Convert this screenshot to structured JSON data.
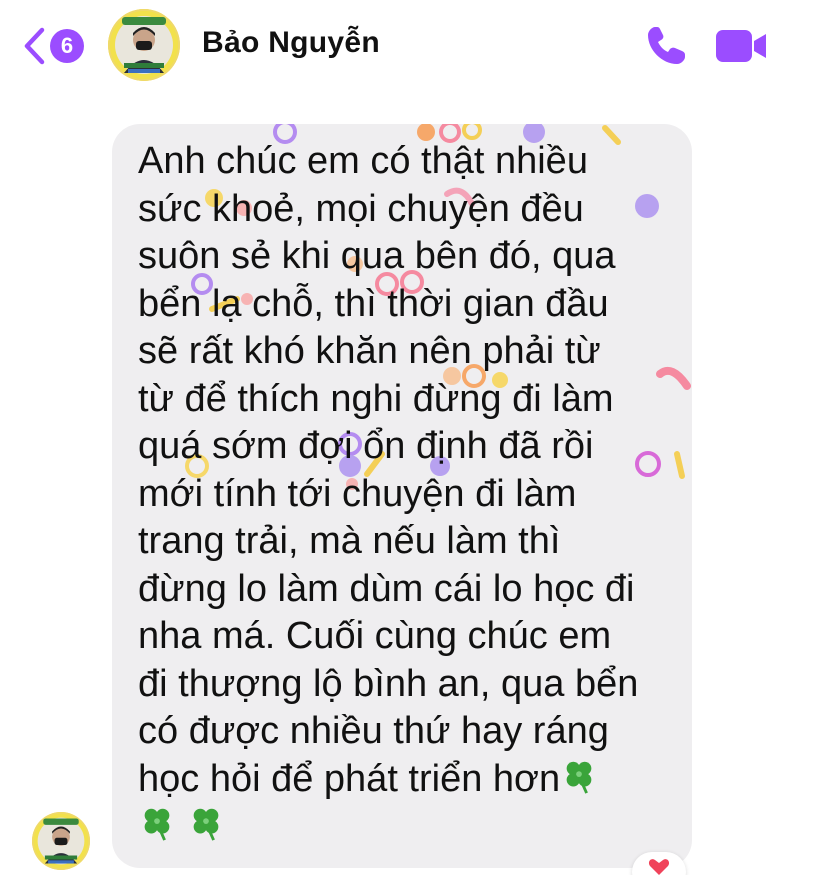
{
  "header": {
    "back_badge": "6",
    "contact_name": "Bảo Nguyễn",
    "avatar_icon": "profile-avatar",
    "call_icon": "phone-icon",
    "video_icon": "video-camera-icon",
    "accent_color": "#9b4dff"
  },
  "message": {
    "lines": [
      "Anh chúc em có thật nhiều",
      "sức khoẻ, mọi chuyện đều",
      "suôn sẻ khi qua bên đó, qua",
      "bển lạ chỗ, thì thời gian đầu",
      "sẽ rất khó khăn nên phải từ",
      "từ để thích nghi đừng đi làm",
      "quá sớm đợi ổn định đã rồi",
      "mới tính tới chuyện đi làm",
      "trang trải, mà nếu làm thì",
      "đừng lo làm dùm cái lo học đi",
      "nha má. Cuối cùng chúc em",
      "đi thượng lộ bình an, qua bển",
      "có được nhiều thứ hay ráng",
      "học hỏi để phát triển hơn"
    ],
    "emoji": "four-leaf-clover",
    "bubble_color": "#efeef0",
    "reaction": "heart"
  }
}
